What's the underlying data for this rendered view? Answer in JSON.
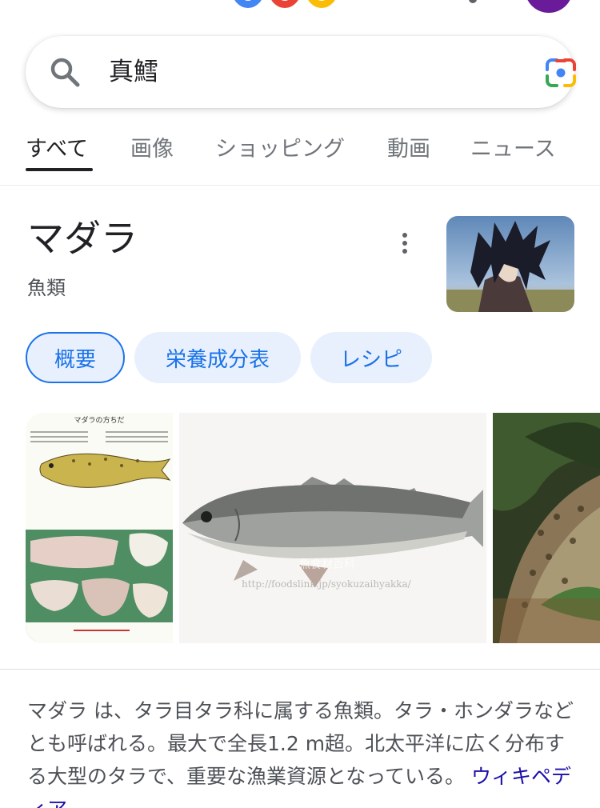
{
  "search": {
    "query": "真鱈"
  },
  "tabs": [
    {
      "label": "すべて"
    },
    {
      "label": "画像"
    },
    {
      "label": "ショッピング"
    },
    {
      "label": "動画"
    },
    {
      "label": "ニュース"
    }
  ],
  "knowledge_panel": {
    "title": "マダラ",
    "subtitle": "魚類",
    "chips": [
      {
        "label": "概要"
      },
      {
        "label": "栄養成分表"
      },
      {
        "label": "レシピ"
      }
    ],
    "images": [
      {
        "caption_title": "マダラの方ちだ"
      },
      {
        "watermark": "http://foodslink.jp/syokuzaihyakka/"
      },
      {}
    ],
    "description_text": "マダラ は、タラ目タラ科に属する魚類。タラ・ホンダラなどとも呼ばれる。最大で全長1.2 m超。北太平洋に広く分布する大型のタラで、重要な漁業資源となっている。",
    "source_link": "ウィキペディア"
  },
  "colors": {
    "accent": "#1a73e8",
    "chip_bg": "#e8f0fe",
    "avatar": "#6a1b9a"
  }
}
